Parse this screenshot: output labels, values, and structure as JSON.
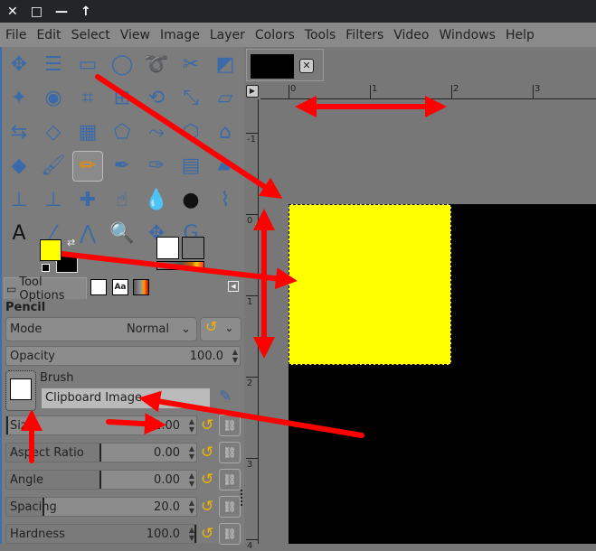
{
  "window": {
    "controls": [
      "close-icon",
      "maximize-icon",
      "minimize-icon",
      "keep-above-icon"
    ]
  },
  "menu": [
    "File",
    "Edit",
    "Select",
    "View",
    "Image",
    "Layer",
    "Colors",
    "Tools",
    "Filters",
    "Video",
    "Windows",
    "Help"
  ],
  "toolbox": {
    "tools": [
      [
        "move",
        "align",
        "rect-select",
        "ellipse-select",
        "free-select",
        "scissors",
        "foreground-select"
      ],
      [
        "fuzzy-select",
        "select-by-color",
        "crop",
        "unified-transform",
        "rotate",
        "scale",
        "shear"
      ],
      [
        "flip",
        "perspective",
        "cage-transform",
        "handle-transform",
        "warp",
        "n-point",
        "paths-lock"
      ],
      [
        "gradient",
        "paintbrush",
        "pencil",
        "airbrush",
        "ink",
        "mypaint",
        "eraser"
      ],
      [
        "clone",
        "heal-perspective",
        "heal",
        "smudge",
        "blur",
        "dodge",
        "paths"
      ],
      [
        "text",
        "color-picker",
        "measure",
        "zoom",
        "move-2",
        "gegl"
      ]
    ],
    "active_tool": "pencil",
    "fg_color": "#ffff00",
    "bg_color": "#000000"
  },
  "tool_options": {
    "tab_label": "Tool Options",
    "title": "Pencil",
    "mode_label": "Mode",
    "mode_value": "Normal",
    "opacity_label": "Opacity",
    "opacity_value": "100.0",
    "brush_label": "Brush",
    "brush_value": "Clipboard Image",
    "params": [
      {
        "label": "Size",
        "value": "2.00",
        "fill": 0.01
      },
      {
        "label": "Aspect Ratio",
        "value": "0.00",
        "fill": 0.5
      },
      {
        "label": "Angle",
        "value": "0.00",
        "fill": 0.5
      },
      {
        "label": "Spacing",
        "value": "20.0",
        "fill": 0.2
      },
      {
        "label": "Hardness",
        "value": "100.0",
        "fill": 1.0
      }
    ]
  },
  "canvas": {
    "hruler": [
      "0",
      "1",
      "2",
      "3"
    ],
    "vruler": [
      "-1",
      "0",
      "1",
      "2",
      "3",
      "4"
    ],
    "image_color": "#ffff00",
    "annotation_color": "#ff0000"
  }
}
